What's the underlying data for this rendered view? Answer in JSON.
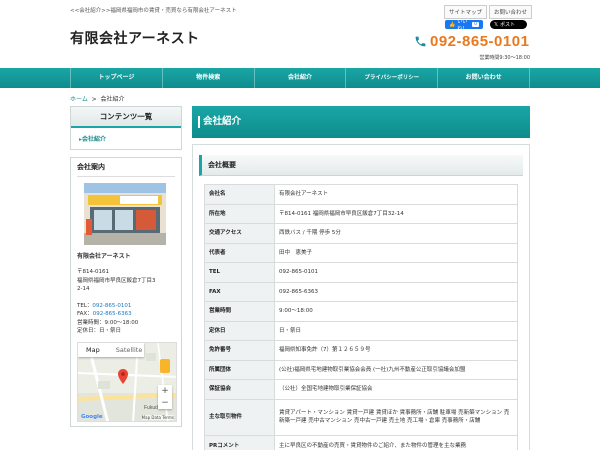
{
  "header": {
    "tagline": "<<会社紹介>>福岡県福岡市の賃貸・売買なら有限会社アーネスト",
    "logo": "有限会社アーネスト",
    "top_links": [
      "サイトマップ",
      "お問い合わせ"
    ],
    "fb_label": "いいね！",
    "fb_count": "0",
    "x_label": "ポスト",
    "phone": "092-865-0101",
    "hours": "営業時間9:30～18:00",
    "accent": "#e8791f"
  },
  "nav": {
    "items": [
      "トップページ",
      "物件検索",
      "会社紹介",
      "プライバシーポリシー",
      "お問い合わせ"
    ],
    "color": "#1aa6a6"
  },
  "breadcrumb": {
    "home": "ホーム",
    "sep": ">",
    "current": "会社紹介"
  },
  "sidebar": {
    "contents_title": "コンテンツ一覧",
    "contents_link": "会社紹介",
    "company_title": "会社案内",
    "company_name": "有限会社アーネスト",
    "zip": "〒814-0161",
    "address": "福岡県福岡市早良区飯倉7丁目3",
    "address2": "2-14",
    "tel_label": "TEL：",
    "tel": "092-865-0101",
    "fax_label": "FAX：",
    "fax": "092-865-6363",
    "hours": "営業時間：9:00～18:00",
    "holiday": "定休日：日・祭日",
    "map_tab1": "Map",
    "map_tab2": "Satellite",
    "map_plus": "+",
    "map_minus": "−",
    "google": "Google",
    "map_data": "Map Data  Terms",
    "road_label": "Fukudai-d"
  },
  "main": {
    "title": "会社紹介",
    "section": "会社概要",
    "rows": [
      {
        "label": "会社名",
        "value": "有限会社アーネスト"
      },
      {
        "label": "所在地",
        "value": "〒814-0161 福岡県福岡市早良区飯倉7丁目32-14"
      },
      {
        "label": "交通アクセス",
        "value": "西鉄バス / 千隈 停歩 5分"
      },
      {
        "label": "代表者",
        "value": "田中　恵美子"
      },
      {
        "label": "TEL",
        "value": "092-865-0101"
      },
      {
        "label": "FAX",
        "value": "092-865-6363"
      },
      {
        "label": "営業時間",
        "value": "9:00～18:00"
      },
      {
        "label": "定休日",
        "value": "日・祭日"
      },
      {
        "label": "免許番号",
        "value": "福岡県知事免許（7）第１２６５９号"
      },
      {
        "label": "所属団体",
        "value": "(公社)福岡県宅地建物取引業協会会員 (一社)九州不動産公正取引協議会加盟"
      },
      {
        "label": "保証協会",
        "value": "（公社）全国宅地建物取引業保証協会"
      },
      {
        "label": "主な取引物件",
        "value": "賃貸アパート・マンション 賃貸一戸建 賃貸ほか 賃事務所・店舗 駐車場 売新築マンション 売新築一戸建 売中古マンション 売中古一戸建 売土地 売工場・倉庫 売事務所・店舗"
      },
      {
        "label": "PRコメント",
        "value": "主に早良区の不動産の売買・賃貸物件のご紹介、また物件の管理を主な業務"
      }
    ]
  }
}
